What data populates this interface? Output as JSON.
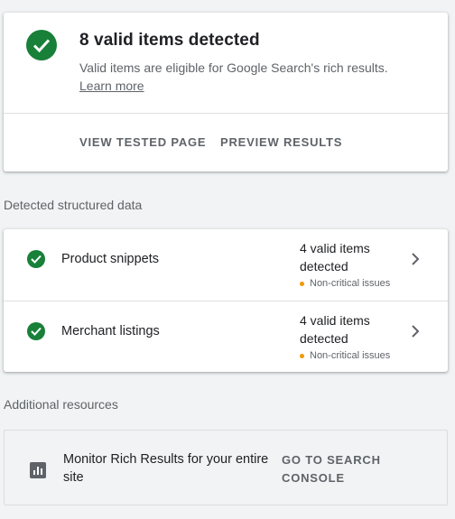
{
  "summary": {
    "title": "8 valid items detected",
    "description": "Valid items are eligible for Google Search's rich results.",
    "learn_more": "Learn more",
    "actions": {
      "view_tested_page": "VIEW TESTED PAGE",
      "preview_results": "PREVIEW RESULTS"
    }
  },
  "detected": {
    "section_label": "Detected structured data",
    "items": [
      {
        "name": "Product snippets",
        "status": "4 valid items detected",
        "warning": "Non-critical issues"
      },
      {
        "name": "Merchant listings",
        "status": "4 valid items detected",
        "warning": "Non-critical issues"
      }
    ]
  },
  "resources": {
    "section_label": "Additional resources",
    "items": [
      {
        "text": "Monitor Rich Results for your entire site",
        "action": "GO TO SEARCH CONSOLE",
        "icon": "bar-chart-icon"
      }
    ]
  },
  "colors": {
    "success": "#188038",
    "warning": "#f29900",
    "text_secondary": "#5f6368"
  }
}
